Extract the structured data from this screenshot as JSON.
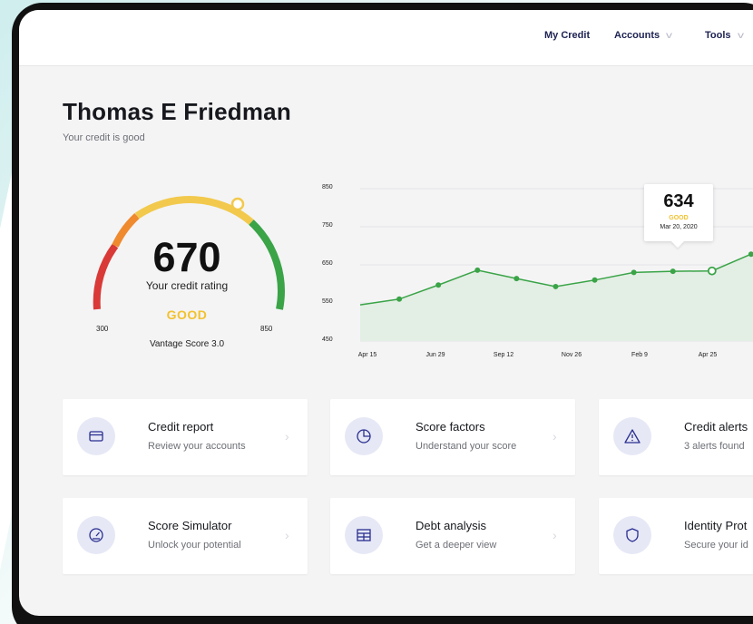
{
  "nav": {
    "my_credit": "My Credit",
    "accounts": "Accounts",
    "tools": "Tools"
  },
  "user": {
    "name": "Thomas E Friedman",
    "status": "Your credit is good"
  },
  "gauge": {
    "score": "670",
    "label": "Your credit rating",
    "rating": "GOOD",
    "min": "300",
    "max": "850",
    "model": "Vantage Score 3.0",
    "score_value": 670,
    "min_value": 300,
    "max_value": 850,
    "colors": [
      "#d93a37",
      "#ef8a2f",
      "#f2c94c",
      "#3aa447"
    ]
  },
  "chart_data": {
    "type": "area",
    "y_ticks": [
      "850",
      "750",
      "650",
      "550",
      "450"
    ],
    "x_ticks": [
      "Apr 15",
      "Jun 29",
      "Sep 12",
      "Nov 26",
      "Feb 9",
      "Apr 25"
    ],
    "ylim": [
      450,
      850
    ],
    "points": [
      545,
      560,
      597,
      636,
      614,
      593,
      610,
      630,
      633,
      634,
      678,
      720
    ],
    "highlight_index": 9,
    "line_color": "#3aa447",
    "fill_color": "#e3eee4"
  },
  "tooltip": {
    "score": "634",
    "rating": "GOOD",
    "date": "Mar 20, 2020"
  },
  "cards": [
    {
      "title": "Credit report",
      "desc": "Review your accounts",
      "icon": "credit-card-icon"
    },
    {
      "title": "Score factors",
      "desc": "Understand your score",
      "icon": "pie-chart-icon"
    },
    {
      "title": "Credit alerts",
      "desc": "3 alerts found",
      "icon": "warning-icon"
    },
    {
      "title": "Score Simulator",
      "desc": "Unlock your potential",
      "icon": "speedometer-icon"
    },
    {
      "title": "Debt analysis",
      "desc": "Get a deeper view",
      "icon": "table-icon"
    },
    {
      "title": "Identity Prot",
      "desc": "Secure your id",
      "icon": "shield-icon"
    }
  ]
}
